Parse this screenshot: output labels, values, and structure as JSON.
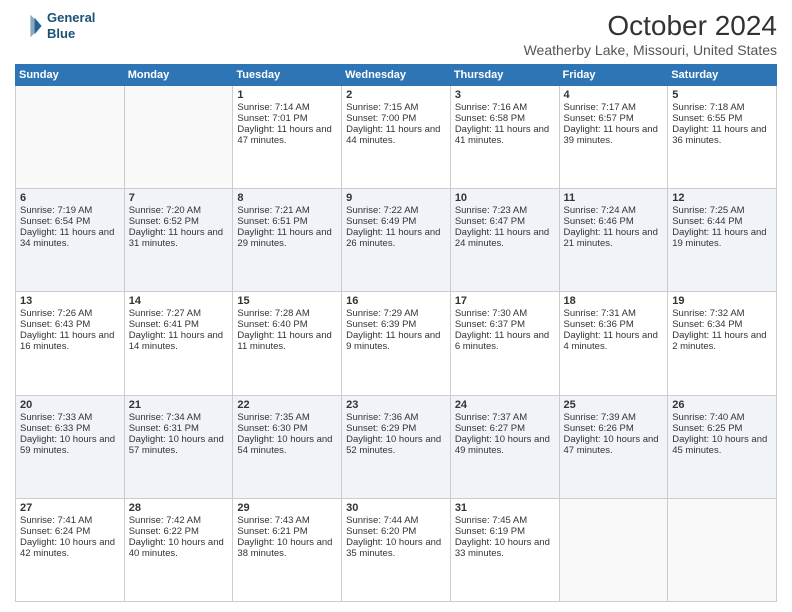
{
  "header": {
    "logo_line1": "General",
    "logo_line2": "Blue",
    "month": "October 2024",
    "location": "Weatherby Lake, Missouri, United States"
  },
  "weekdays": [
    "Sunday",
    "Monday",
    "Tuesday",
    "Wednesday",
    "Thursday",
    "Friday",
    "Saturday"
  ],
  "weeks": [
    [
      {
        "day": "",
        "sunrise": "",
        "sunset": "",
        "daylight": ""
      },
      {
        "day": "",
        "sunrise": "",
        "sunset": "",
        "daylight": ""
      },
      {
        "day": "1",
        "sunrise": "Sunrise: 7:14 AM",
        "sunset": "Sunset: 7:01 PM",
        "daylight": "Daylight: 11 hours and 47 minutes."
      },
      {
        "day": "2",
        "sunrise": "Sunrise: 7:15 AM",
        "sunset": "Sunset: 7:00 PM",
        "daylight": "Daylight: 11 hours and 44 minutes."
      },
      {
        "day": "3",
        "sunrise": "Sunrise: 7:16 AM",
        "sunset": "Sunset: 6:58 PM",
        "daylight": "Daylight: 11 hours and 41 minutes."
      },
      {
        "day": "4",
        "sunrise": "Sunrise: 7:17 AM",
        "sunset": "Sunset: 6:57 PM",
        "daylight": "Daylight: 11 hours and 39 minutes."
      },
      {
        "day": "5",
        "sunrise": "Sunrise: 7:18 AM",
        "sunset": "Sunset: 6:55 PM",
        "daylight": "Daylight: 11 hours and 36 minutes."
      }
    ],
    [
      {
        "day": "6",
        "sunrise": "Sunrise: 7:19 AM",
        "sunset": "Sunset: 6:54 PM",
        "daylight": "Daylight: 11 hours and 34 minutes."
      },
      {
        "day": "7",
        "sunrise": "Sunrise: 7:20 AM",
        "sunset": "Sunset: 6:52 PM",
        "daylight": "Daylight: 11 hours and 31 minutes."
      },
      {
        "day": "8",
        "sunrise": "Sunrise: 7:21 AM",
        "sunset": "Sunset: 6:51 PM",
        "daylight": "Daylight: 11 hours and 29 minutes."
      },
      {
        "day": "9",
        "sunrise": "Sunrise: 7:22 AM",
        "sunset": "Sunset: 6:49 PM",
        "daylight": "Daylight: 11 hours and 26 minutes."
      },
      {
        "day": "10",
        "sunrise": "Sunrise: 7:23 AM",
        "sunset": "Sunset: 6:47 PM",
        "daylight": "Daylight: 11 hours and 24 minutes."
      },
      {
        "day": "11",
        "sunrise": "Sunrise: 7:24 AM",
        "sunset": "Sunset: 6:46 PM",
        "daylight": "Daylight: 11 hours and 21 minutes."
      },
      {
        "day": "12",
        "sunrise": "Sunrise: 7:25 AM",
        "sunset": "Sunset: 6:44 PM",
        "daylight": "Daylight: 11 hours and 19 minutes."
      }
    ],
    [
      {
        "day": "13",
        "sunrise": "Sunrise: 7:26 AM",
        "sunset": "Sunset: 6:43 PM",
        "daylight": "Daylight: 11 hours and 16 minutes."
      },
      {
        "day": "14",
        "sunrise": "Sunrise: 7:27 AM",
        "sunset": "Sunset: 6:41 PM",
        "daylight": "Daylight: 11 hours and 14 minutes."
      },
      {
        "day": "15",
        "sunrise": "Sunrise: 7:28 AM",
        "sunset": "Sunset: 6:40 PM",
        "daylight": "Daylight: 11 hours and 11 minutes."
      },
      {
        "day": "16",
        "sunrise": "Sunrise: 7:29 AM",
        "sunset": "Sunset: 6:39 PM",
        "daylight": "Daylight: 11 hours and 9 minutes."
      },
      {
        "day": "17",
        "sunrise": "Sunrise: 7:30 AM",
        "sunset": "Sunset: 6:37 PM",
        "daylight": "Daylight: 11 hours and 6 minutes."
      },
      {
        "day": "18",
        "sunrise": "Sunrise: 7:31 AM",
        "sunset": "Sunset: 6:36 PM",
        "daylight": "Daylight: 11 hours and 4 minutes."
      },
      {
        "day": "19",
        "sunrise": "Sunrise: 7:32 AM",
        "sunset": "Sunset: 6:34 PM",
        "daylight": "Daylight: 11 hours and 2 minutes."
      }
    ],
    [
      {
        "day": "20",
        "sunrise": "Sunrise: 7:33 AM",
        "sunset": "Sunset: 6:33 PM",
        "daylight": "Daylight: 10 hours and 59 minutes."
      },
      {
        "day": "21",
        "sunrise": "Sunrise: 7:34 AM",
        "sunset": "Sunset: 6:31 PM",
        "daylight": "Daylight: 10 hours and 57 minutes."
      },
      {
        "day": "22",
        "sunrise": "Sunrise: 7:35 AM",
        "sunset": "Sunset: 6:30 PM",
        "daylight": "Daylight: 10 hours and 54 minutes."
      },
      {
        "day": "23",
        "sunrise": "Sunrise: 7:36 AM",
        "sunset": "Sunset: 6:29 PM",
        "daylight": "Daylight: 10 hours and 52 minutes."
      },
      {
        "day": "24",
        "sunrise": "Sunrise: 7:37 AM",
        "sunset": "Sunset: 6:27 PM",
        "daylight": "Daylight: 10 hours and 49 minutes."
      },
      {
        "day": "25",
        "sunrise": "Sunrise: 7:39 AM",
        "sunset": "Sunset: 6:26 PM",
        "daylight": "Daylight: 10 hours and 47 minutes."
      },
      {
        "day": "26",
        "sunrise": "Sunrise: 7:40 AM",
        "sunset": "Sunset: 6:25 PM",
        "daylight": "Daylight: 10 hours and 45 minutes."
      }
    ],
    [
      {
        "day": "27",
        "sunrise": "Sunrise: 7:41 AM",
        "sunset": "Sunset: 6:24 PM",
        "daylight": "Daylight: 10 hours and 42 minutes."
      },
      {
        "day": "28",
        "sunrise": "Sunrise: 7:42 AM",
        "sunset": "Sunset: 6:22 PM",
        "daylight": "Daylight: 10 hours and 40 minutes."
      },
      {
        "day": "29",
        "sunrise": "Sunrise: 7:43 AM",
        "sunset": "Sunset: 6:21 PM",
        "daylight": "Daylight: 10 hours and 38 minutes."
      },
      {
        "day": "30",
        "sunrise": "Sunrise: 7:44 AM",
        "sunset": "Sunset: 6:20 PM",
        "daylight": "Daylight: 10 hours and 35 minutes."
      },
      {
        "day": "31",
        "sunrise": "Sunrise: 7:45 AM",
        "sunset": "Sunset: 6:19 PM",
        "daylight": "Daylight: 10 hours and 33 minutes."
      },
      {
        "day": "",
        "sunrise": "",
        "sunset": "",
        "daylight": ""
      },
      {
        "day": "",
        "sunrise": "",
        "sunset": "",
        "daylight": ""
      }
    ]
  ]
}
